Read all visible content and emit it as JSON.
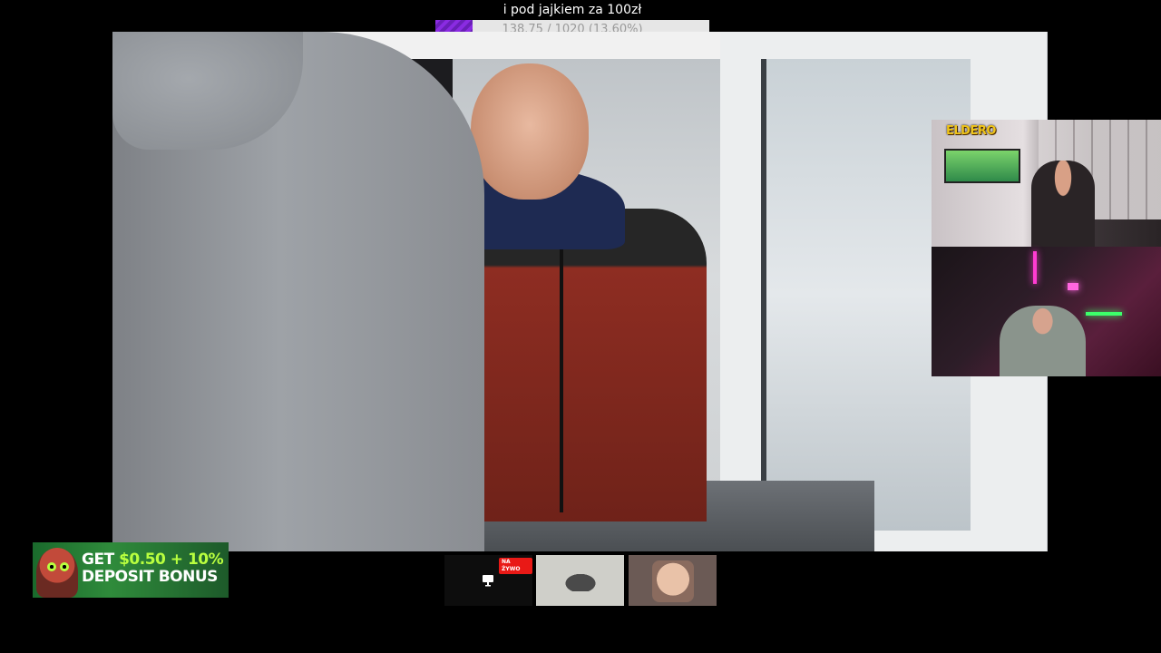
{
  "goal": {
    "title": "i pod jajkiem za 100zł",
    "progress_text": "138.75 / 1020 (13.60%)",
    "progress_fraction": 0.136,
    "accent_color": "#8a2be2"
  },
  "webcam": {
    "logo": "ELDERO"
  },
  "banner": {
    "line1_prefix": "GET ",
    "line1_amount": "$0.50 + 10%",
    "line2": "DEPOSIT BONUS",
    "highlight_color": "#b9ff3f"
  },
  "thumbnails": {
    "live_badge": "NA ŻYWO",
    "live_icon": "monitor-icon",
    "items": [
      "live-stream",
      "car-video",
      "face-emote"
    ]
  }
}
